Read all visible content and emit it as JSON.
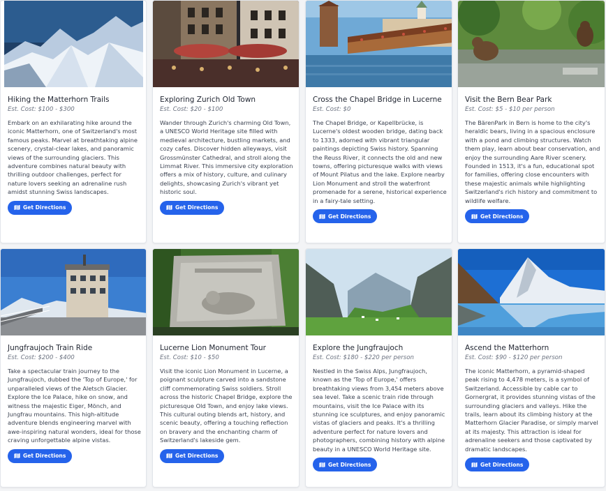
{
  "button_label": "Get Directions",
  "colors": {
    "accent": "#2563eb",
    "page_bg": "#f3f4f6",
    "card_bg": "#ffffff"
  },
  "cards": [
    {
      "title": "Hiking the Matterhorn Trails",
      "cost": "Est. Cost: $100 - $300",
      "description": "Embark on an exhilarating hike around the iconic Matterhorn, one of Switzerland's most famous peaks. Marvel at breathtaking alpine scenery, crystal-clear lakes, and panoramic views of the surrounding glaciers. This adventure combines natural beauty with thrilling outdoor challenges, perfect for nature lovers seeking an adrenaline rush amidst stunning Swiss landscapes.",
      "image": "snowy-mountain-peaks"
    },
    {
      "title": "Exploring Zurich Old Town",
      "cost": "Est. Cost: $20 - $100",
      "description": "Wander through Zurich's charming Old Town, a UNESCO World Heritage site filled with medieval architecture, bustling markets, and cozy cafes. Discover hidden alleyways, visit Grossmünster Cathedral, and stroll along the Limmat River. This immersive city exploration offers a mix of history, culture, and culinary delights, showcasing Zurich's vibrant yet historic soul.",
      "image": "old-town-night-square"
    },
    {
      "title": "Cross the Chapel Bridge in Lucerne",
      "cost": "Est. Cost: $0",
      "description": "The Chapel Bridge, or Kapellbrücke, is Lucerne's oldest wooden bridge, dating back to 1333, adorned with vibrant triangular paintings depicting Swiss history. Spanning the Reuss River, it connects the old and new towns, offering picturesque walks with views of Mount Pilatus and the lake. Explore nearby Lion Monument and stroll the waterfront promenade for a serene, historical experience in a fairy-tale setting.",
      "image": "chapel-bridge-river"
    },
    {
      "title": "Visit the Bern Bear Park",
      "cost": "Est. Cost: $5 - $10 per person",
      "description": "The BärenPark in Bern is home to the city's heraldic bears, living in a spacious enclosure with a pond and climbing structures. Watch them play, learn about bear conservation, and enjoy the surrounding Aare River scenery. Founded in 1513, it's a fun, educational spot for families, offering close encounters with these majestic animals while highlighting Switzerland's rich history and commitment to wildlife welfare.",
      "image": "bears-in-park"
    },
    {
      "title": "Jungfraujoch Train Ride",
      "cost": "Est. Cost: $200 - $400",
      "description": "Take a spectacular train journey to the Jungfraujoch, dubbed the 'Top of Europe,' for unparalleled views of the Aletsch Glacier. Explore the Ice Palace, hike on snow, and witness the majestic Eiger, Mönch, and Jungfrau mountains. This high-altitude adventure blends engineering marvel with awe-inspiring natural wonders, ideal for those craving unforgettable alpine vistas.",
      "image": "mountain-observatory"
    },
    {
      "title": "Lucerne Lion Monument Tour",
      "cost": "Est. Cost: $10 - $50",
      "description": "Visit the iconic Lion Monument in Lucerne, a poignant sculpture carved into a sandstone cliff commemorating Swiss soldiers. Stroll across the historic Chapel Bridge, explore the picturesque Old Town, and enjoy lake views. This cultural outing blends art, history, and scenic beauty, offering a touching reflection on bravery and the enchanting charm of Switzerland's lakeside gem.",
      "image": "lion-monument-cliff"
    },
    {
      "title": "Explore the Jungfraujoch",
      "cost": "Est. Cost: $180 - $220 per person",
      "description": "Nestled in the Swiss Alps, Jungfraujoch, known as the 'Top of Europe,' offers breathtaking views from 3,454 meters above sea level. Take a scenic train ride through mountains, visit the Ice Palace with its stunning ice sculptures, and enjoy panoramic vistas of glaciers and peaks. It's a thrilling adventure perfect for nature lovers and photographers, combining history with alpine beauty in a UNESCO World Heritage site.",
      "image": "green-alpine-valley"
    },
    {
      "title": "Ascend the Matterhorn",
      "cost": "Est. Cost: $90 - $120 per person",
      "description": "The iconic Matterhorn, a pyramid-shaped peak rising to 4,478 meters, is a symbol of Switzerland. Accessible by cable car to Gornergrat, it provides stunning vistas of the surrounding glaciers and valleys. Hike the trails, learn about its climbing history at the Matterhorn Glacier Paradise, or simply marvel at its majesty. This attraction is ideal for adrenaline seekers and those captivated by dramatic landscapes.",
      "image": "matterhorn-lake-reflection"
    }
  ]
}
